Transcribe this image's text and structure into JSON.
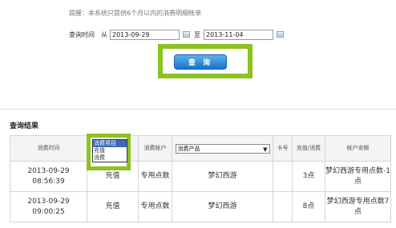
{
  "notice": "提醒：本系统只提供6个月以内的消费明细帐单",
  "query": {
    "label": "查询时间",
    "from_label": "从",
    "from_date": "2013-09-29",
    "to_label": "至",
    "to_date": "2013-11-04",
    "button_label": "查 询"
  },
  "results": {
    "title": "查询结果",
    "columns": {
      "time": "消费时间",
      "account": "消费帐户",
      "product_select": "消费产品",
      "card": "卡号",
      "amount": "充值/消费",
      "balance": "帐户余额"
    },
    "type_dropdown": {
      "options": [
        "消费项目",
        "充值",
        "消费"
      ],
      "selected": "消费项目"
    },
    "rows": [
      {
        "date": "2013-09-29",
        "time": "08:56:39",
        "type": "充值",
        "account": "专用点数",
        "product": "梦幻西游",
        "card": "",
        "amount": "3点",
        "balance": "梦幻西游专用点数-1点"
      },
      {
        "date": "2013-09-29",
        "time": "09:00:25",
        "type": "充值",
        "account": "专用点数",
        "product": "梦幻西游",
        "card": "",
        "amount": "8点",
        "balance": "梦幻西游专用点数7点"
      }
    ]
  },
  "colors": {
    "highlight": "#8dc21f",
    "button": "#1973c6"
  }
}
